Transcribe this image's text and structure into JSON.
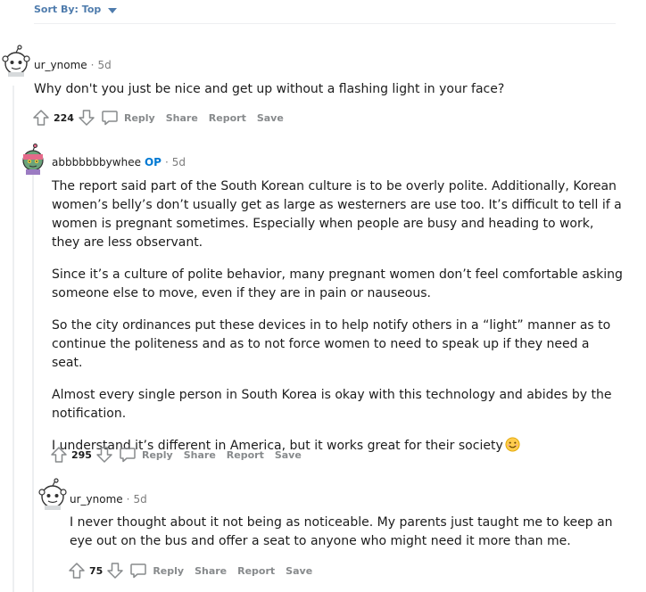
{
  "sort": {
    "label": "Sort By: Top"
  },
  "comments": [
    {
      "username": "ur_ynome",
      "time": "5d",
      "paragraphs": [
        "Why don't you just be nice and get up without a flashing light in your face?"
      ],
      "score": "224",
      "actions": {
        "reply": "Reply",
        "share": "Share",
        "report": "Report",
        "save": "Save"
      }
    },
    {
      "username": "abbbbbbbywhee",
      "op_badge": "OP",
      "time": "5d",
      "paragraphs": [
        "The report said part of the South Korean culture is to be overly polite. Additionally, Korean women’s belly’s don’t usually get as large as westerners are use too. It’s difficult to tell if a women is pregnant sometimes. Especially when people are busy and heading to work, they are less observant.",
        "Since it’s a culture of polite behavior, many pregnant women don’t feel comfortable asking someone else to move, even if they are in pain or nauseous.",
        "So the city ordinances put these devices in to help notify others in a “light” manner as to continue the politeness and as to not force women to need to speak up if they need a seat.",
        "Almost every single person in South Korea is okay with this technology and abides by the notification.",
        "I understand it’s different in America, but it works great for their society"
      ],
      "score": "295",
      "actions": {
        "reply": "Reply",
        "share": "Share",
        "report": "Report",
        "save": "Save"
      }
    },
    {
      "username": "ur_ynome",
      "time": "5d",
      "paragraphs": [
        "I never thought about it not being as noticeable. My parents just taught me to keep an eye out on the bus and offer a seat to anyone who might need it more than me."
      ],
      "score": "75",
      "actions": {
        "reply": "Reply",
        "share": "Share",
        "report": "Report",
        "save": "Save"
      }
    }
  ],
  "icons": {
    "upvote": "upvote-arrow-icon",
    "downvote": "downvote-arrow-icon",
    "reply": "speech-bubble-icon",
    "emoji": "smiling-face-emoji",
    "avatar_default": "snoo-avatar",
    "avatar_op": "snoo-avatar-green"
  },
  "colors": {
    "accent": "#4f7cad",
    "op_badge": "#0079d3",
    "muted": "#878a8c",
    "thread_line": "#edeff1"
  }
}
